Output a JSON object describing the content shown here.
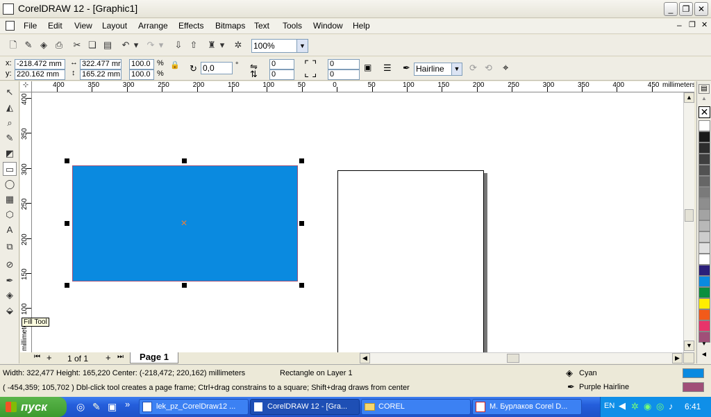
{
  "window": {
    "title": "CorelDRAW 12 - [Graphic1]"
  },
  "window_buttons": {
    "minimize": "_",
    "restore": "❐",
    "close": "✕"
  },
  "menu": [
    "File",
    "Edit",
    "View",
    "Layout",
    "Arrange",
    "Effects",
    "Bitmaps",
    "Text",
    "Tools",
    "Window",
    "Help"
  ],
  "standard_bar": {
    "zoom": "100%"
  },
  "property_bar": {
    "x_label": "x:",
    "x": "-218.472 mm",
    "y_label": "y:",
    "y": "220.162 mm",
    "width": "322.477 mr",
    "height": "165.22 mm",
    "scale_w": "100.0",
    "scale_h": "100.0",
    "pct": "%",
    "rotation": "0,0",
    "deg": "°",
    "corner_a": "0",
    "corner_b": "0",
    "corner_c": "0",
    "corner_d": "0",
    "outline": "Hairline"
  },
  "rulers": {
    "unit": "millimeters",
    "h_labels": [
      "400",
      "350",
      "300",
      "250",
      "200",
      "150",
      "100",
      "50",
      "0",
      "50",
      "100",
      "150",
      "200",
      "250",
      "300",
      "350",
      "400",
      "450"
    ],
    "v_labels": [
      "400",
      "350",
      "300",
      "250",
      "200",
      "150",
      "100"
    ]
  },
  "tooltip": "Fill Tool",
  "page_nav": {
    "counter": "1 of 1",
    "tab": "Page 1"
  },
  "colors": {
    "rect_fill": "#0a8ae0",
    "outline": "#9a4f77"
  },
  "palette": [
    "#ffffff",
    "#1a1a1a",
    "#2d2d2d",
    "#3f3f3f",
    "#525252",
    "#666666",
    "#7a7a7a",
    "#8e8e8e",
    "#a3a3a3",
    "#b8b8b8",
    "#cccccc",
    "#e0e0e0",
    "#ffffff",
    "#2b1f7a",
    "#0a8ae0",
    "#0b8f3e",
    "#ffee00",
    "#f25a1a",
    "#e8346a",
    "#a04f78"
  ],
  "status": {
    "line1": "Width: 322,477  Height: 165,220  Center: (-218,472; 220,162)  millimeters",
    "object": "Rectangle on Layer 1",
    "line2": "( -454,359; 105,702 )   Dbl-click tool creates a page frame; Ctrl+drag constrains to a square; Shift+drag draws from center",
    "fill_name": "Cyan",
    "outline_name": "Purple  Hairline"
  },
  "taskbar": {
    "start": "пуск",
    "tasks": [
      "lek_pz_CorelDraw12 ...",
      "CorelDRAW 12 - [Gra...",
      "COREL",
      "М. Бурлаков Corel D..."
    ],
    "lang": "EN",
    "time": "6:41"
  }
}
